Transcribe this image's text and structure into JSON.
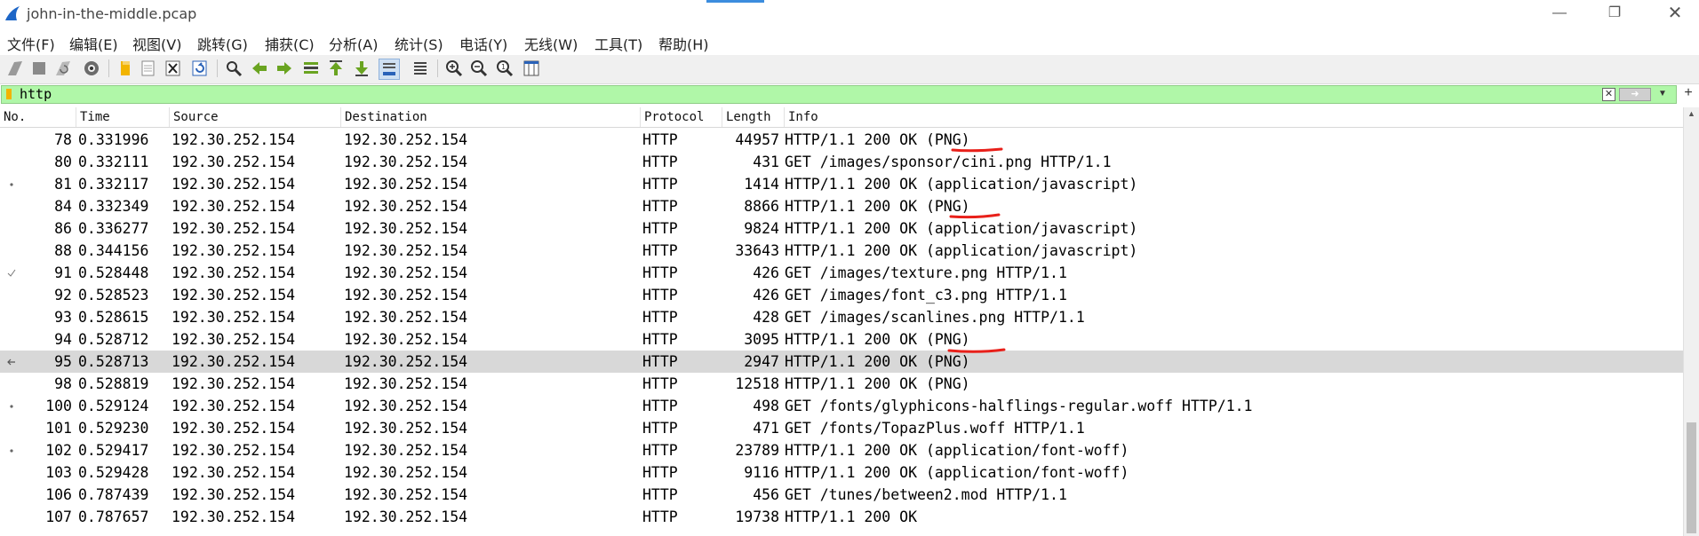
{
  "window": {
    "title": "john-in-the-middle.pcap",
    "minimize_icon": "minimize-icon",
    "maximize_icon": "restore-icon",
    "close_icon": "close-icon"
  },
  "menu": {
    "items": [
      {
        "label": "文件(F)"
      },
      {
        "label": "编辑(E)"
      },
      {
        "label": "视图(V)"
      },
      {
        "label": "跳转(G)"
      },
      {
        "label": "捕获(C)"
      },
      {
        "label": "分析(A)"
      },
      {
        "label": "统计(S)"
      },
      {
        "label": "电话(Y)"
      },
      {
        "label": "无线(W)"
      },
      {
        "label": "工具(T)"
      },
      {
        "label": "帮助(H)"
      }
    ]
  },
  "toolbar": {
    "buttons": [
      "start-capture-icon",
      "stop-capture-icon",
      "restart-capture-icon",
      "capture-options-icon",
      "open-file-icon",
      "save-file-icon",
      "close-file-icon",
      "reload-file-icon",
      "find-packet-icon",
      "go-back-icon",
      "go-forward-icon",
      "go-to-packet-icon",
      "first-packet-icon",
      "last-packet-icon",
      "autoscroll-icon",
      "colorize-icon",
      "zoom-in-icon",
      "zoom-out-icon",
      "zoom-reset-icon",
      "resize-columns-icon"
    ]
  },
  "filter": {
    "value": "http",
    "clear_icon": "clear-filter-icon",
    "apply_icon": "apply-filter-icon",
    "dropdown_icon": "filter-dropdown-icon",
    "add_icon": "add-filter-button-icon"
  },
  "colors": {
    "filter_bg": "#b0f7a8",
    "selected_row": "#d8d8d8",
    "annotation": "#e8201a"
  },
  "columns": {
    "no": "No.",
    "time": "Time",
    "source": "Source",
    "destination": "Destination",
    "protocol": "Protocol",
    "length": "Length",
    "info": "Info"
  },
  "packets": [
    {
      "no": "78",
      "time": "0.331996",
      "src": "192.30.252.154",
      "dst": "192.30.252.154",
      "proto": "HTTP",
      "len": "44957",
      "info": "HTTP/1.1 200 OK  (PNG)"
    },
    {
      "no": "80",
      "time": "0.332111",
      "src": "192.30.252.154",
      "dst": "192.30.252.154",
      "proto": "HTTP",
      "len": "431",
      "info": "GET /images/sponsor/cini.png HTTP/1.1"
    },
    {
      "no": "81",
      "time": "0.332117",
      "src": "192.30.252.154",
      "dst": "192.30.252.154",
      "proto": "HTTP",
      "len": "1414",
      "info": "HTTP/1.1 200 OK  (application/javascript)"
    },
    {
      "no": "84",
      "time": "0.332349",
      "src": "192.30.252.154",
      "dst": "192.30.252.154",
      "proto": "HTTP",
      "len": "8866",
      "info": "HTTP/1.1 200 OK  (PNG)"
    },
    {
      "no": "86",
      "time": "0.336277",
      "src": "192.30.252.154",
      "dst": "192.30.252.154",
      "proto": "HTTP",
      "len": "9824",
      "info": "HTTP/1.1 200 OK  (application/javascript)"
    },
    {
      "no": "88",
      "time": "0.344156",
      "src": "192.30.252.154",
      "dst": "192.30.252.154",
      "proto": "HTTP",
      "len": "33643",
      "info": "HTTP/1.1 200 OK  (application/javascript)"
    },
    {
      "no": "91",
      "time": "0.528448",
      "src": "192.30.252.154",
      "dst": "192.30.252.154",
      "proto": "HTTP",
      "len": "426",
      "info": "GET /images/texture.png HTTP/1.1"
    },
    {
      "no": "92",
      "time": "0.528523",
      "src": "192.30.252.154",
      "dst": "192.30.252.154",
      "proto": "HTTP",
      "len": "426",
      "info": "GET /images/font_c3.png HTTP/1.1"
    },
    {
      "no": "93",
      "time": "0.528615",
      "src": "192.30.252.154",
      "dst": "192.30.252.154",
      "proto": "HTTP",
      "len": "428",
      "info": "GET /images/scanlines.png HTTP/1.1"
    },
    {
      "no": "94",
      "time": "0.528712",
      "src": "192.30.252.154",
      "dst": "192.30.252.154",
      "proto": "HTTP",
      "len": "3095",
      "info": "HTTP/1.1 200 OK  (PNG)"
    },
    {
      "no": "95",
      "time": "0.528713",
      "src": "192.30.252.154",
      "dst": "192.30.252.154",
      "proto": "HTTP",
      "len": "2947",
      "info": "HTTP/1.1 200 OK  (PNG)"
    },
    {
      "no": "98",
      "time": "0.528819",
      "src": "192.30.252.154",
      "dst": "192.30.252.154",
      "proto": "HTTP",
      "len": "12518",
      "info": "HTTP/1.1 200 OK  (PNG)"
    },
    {
      "no": "100",
      "time": "0.529124",
      "src": "192.30.252.154",
      "dst": "192.30.252.154",
      "proto": "HTTP",
      "len": "498",
      "info": "GET /fonts/glyphicons-halflings-regular.woff HTTP/1.1"
    },
    {
      "no": "101",
      "time": "0.529230",
      "src": "192.30.252.154",
      "dst": "192.30.252.154",
      "proto": "HTTP",
      "len": "471",
      "info": "GET /fonts/TopazPlus.woff HTTP/1.1"
    },
    {
      "no": "102",
      "time": "0.529417",
      "src": "192.30.252.154",
      "dst": "192.30.252.154",
      "proto": "HTTP",
      "len": "23789",
      "info": "HTTP/1.1 200 OK  (application/font-woff)"
    },
    {
      "no": "103",
      "time": "0.529428",
      "src": "192.30.252.154",
      "dst": "192.30.252.154",
      "proto": "HTTP",
      "len": "9116",
      "info": "HTTP/1.1 200 OK  (application/font-woff)"
    },
    {
      "no": "106",
      "time": "0.787439",
      "src": "192.30.252.154",
      "dst": "192.30.252.154",
      "proto": "HTTP",
      "len": "456",
      "info": "GET /tunes/between2.mod HTTP/1.1"
    },
    {
      "no": "107",
      "time": "0.787657",
      "src": "192.30.252.154",
      "dst": "192.30.252.154",
      "proto": "HTTP",
      "len": "19738",
      "info": "HTTP/1.1 200 OK"
    }
  ]
}
